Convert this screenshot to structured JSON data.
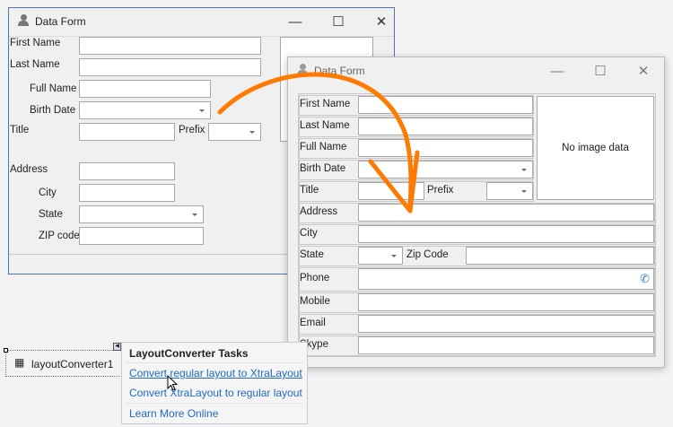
{
  "old_form": {
    "title": "Data Form",
    "fields": {
      "first_name": "First Name",
      "last_name": "Last Name",
      "full_name": "Full Name",
      "birth_date": "Birth Date",
      "title": "Title",
      "prefix": "Prefix",
      "address": "Address",
      "city": "City",
      "state": "State",
      "zip": "ZIP code"
    }
  },
  "new_form": {
    "title": "Data Form",
    "image_placeholder": "No image data",
    "fields": {
      "first_name": "First Name",
      "last_name": "Last Name",
      "full_name": "Full Name",
      "birth_date": "Birth Date",
      "title": "Title",
      "prefix": "Prefix",
      "address": "Address",
      "city": "City",
      "state": "State",
      "zip": "Zip Code",
      "phone": "Phone",
      "mobile": "Mobile",
      "email": "Email",
      "skype": "Skype"
    }
  },
  "component": {
    "name": "layoutConverter1"
  },
  "tasks": {
    "header": "LayoutConverter Tasks",
    "items": [
      "Convert regular layout to XtraLayout",
      "Convert XtraLayout to regular layout",
      "Learn More Online"
    ]
  },
  "colors": {
    "arrow": "#ff7a00",
    "link": "#1e6ac0",
    "phone_icon": "#3c7fc8"
  }
}
